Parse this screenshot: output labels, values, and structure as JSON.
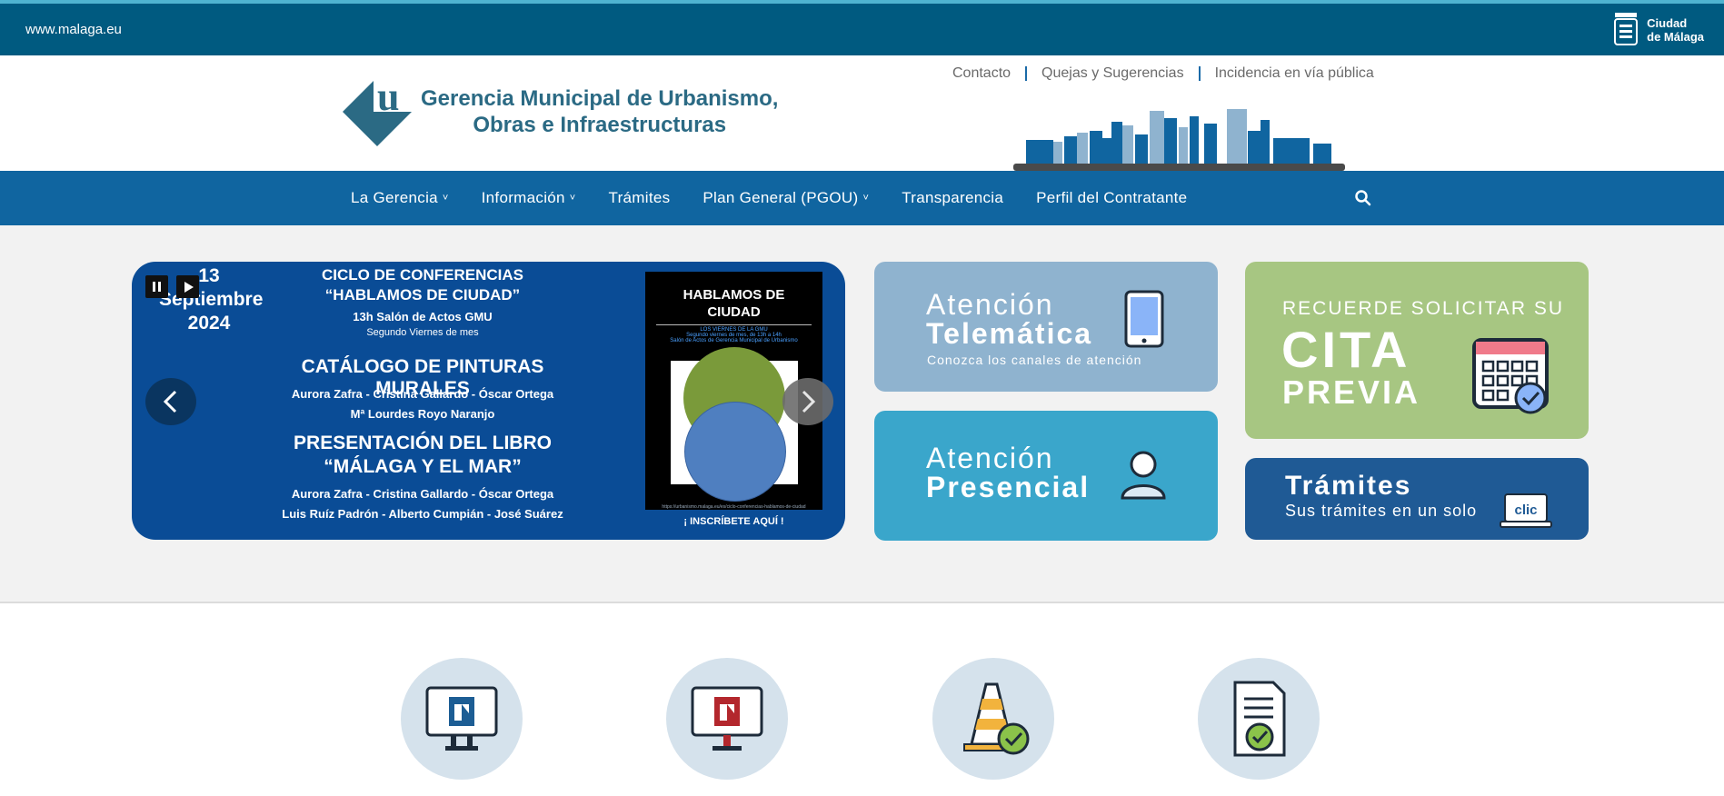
{
  "topbar": {
    "site_link": "www.malaga.eu",
    "brand_line1": "Ciudad",
    "brand_line2": "de Málaga"
  },
  "header": {
    "logo_line1": "Gerencia Municipal de Urbanismo,",
    "logo_line2": "Obras e Infraestructuras",
    "quick_links": [
      "Contacto",
      "Quejas y Sugerencias",
      "Incidencia en vía pública"
    ]
  },
  "nav": {
    "items": [
      {
        "label": "La Gerencia",
        "dropdown": true
      },
      {
        "label": "Información",
        "dropdown": true
      },
      {
        "label": "Trámites",
        "dropdown": false
      },
      {
        "label": "Plan General (PGOU)",
        "dropdown": true
      },
      {
        "label": "Transparencia",
        "dropdown": false
      },
      {
        "label": "Perfil del Contratante",
        "dropdown": false
      }
    ],
    "chevron": "˅",
    "search_icon": "search-icon"
  },
  "slider": {
    "date_day": "13",
    "date_month": "Septiembre",
    "date_year": "2024",
    "title1": "CICLO DE CONFERENCIAS",
    "title2": "“HABLAMOS DE CIUDAD”",
    "place": "13h Salón de Actos GMU",
    "frequency": "Segundo Viernes de mes",
    "section1_title": "CATÁLOGO DE PINTURAS MURALES",
    "section1_authors1": "Aurora Zafra - Cristina Gallardo - Óscar Ortega",
    "section1_authors2": "Mª Lourdes Royo Naranjo",
    "section2_title1": "PRESENTACIÓN DEL LIBRO",
    "section2_title2": "“MÁLAGA Y EL MAR”",
    "section2_authors1": "Aurora Zafra - Cristina Gallardo - Óscar Ortega",
    "section2_authors2": "Luis Ruíz Padrón - Alberto Cumpián - José Suárez",
    "poster_title1": "HABLAMOS DE",
    "poster_title2": "CIUDAD",
    "poster_sub1": "LOS VIERNES DE LA GMU",
    "poster_sub2": "Segundo viernes de mes, de 13h a 14h",
    "poster_sub3": "Salón de Actos de Gerencia Municipal de Urbanismo",
    "poster_url": "https://urbanismo.malaga.eu/es/ciclo-conferencias-hablamos-de-ciudad",
    "cta": "¡ INSCRÍBETE AQUÍ !"
  },
  "tiles": {
    "telematica": {
      "line1": "Atención",
      "line2": "Telemática",
      "sub": "Conozca los canales de atención",
      "icon": "tablet-icon"
    },
    "presencial": {
      "line1": "Atención",
      "line2": "Presencial",
      "icon": "person-icon"
    },
    "cita": {
      "line1": "RECUERDE SOLICITAR SU",
      "line2": "CITA",
      "line3": "PREVIA",
      "icon": "calendar-check-icon"
    },
    "tramites": {
      "line1": "Trámites",
      "line2": "Sus trámites en un solo",
      "badge": "clic",
      "icon": "laptop-icon"
    }
  },
  "bottom_icons": [
    "monitor-blue-icon",
    "monitor-red-icon",
    "traffic-cone-check-icon",
    "document-check-icon"
  ],
  "colors": {
    "topbar": "#005a80",
    "nav": "#1065a0",
    "telematica": "#8fb3cf",
    "presencial": "#3aa6cb",
    "cita": "#a7c682",
    "tramites": "#1f5a95"
  }
}
